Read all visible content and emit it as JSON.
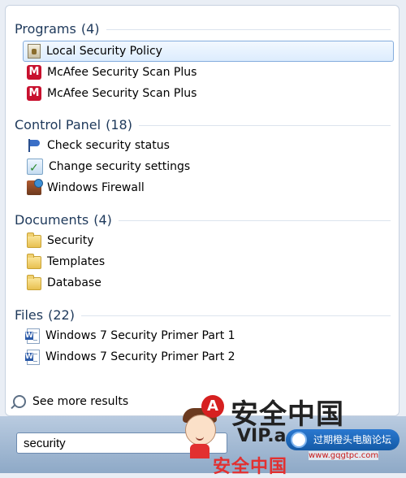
{
  "sections": [
    {
      "title": "Programs",
      "count": "(4)",
      "items": [
        {
          "label": "Local Security Policy",
          "icon": "security-policy-icon",
          "selected": true
        },
        {
          "label": "McAfee Security Scan Plus",
          "icon": "mcafee-icon"
        },
        {
          "label": "McAfee Security Scan Plus",
          "icon": "mcafee-icon"
        }
      ]
    },
    {
      "title": "Control Panel",
      "count": "(18)",
      "items": [
        {
          "label": "Check security status",
          "icon": "action-center-flag-icon"
        },
        {
          "label": "Change security settings",
          "icon": "security-settings-icon"
        },
        {
          "label": "Windows Firewall",
          "icon": "firewall-icon"
        }
      ]
    },
    {
      "title": "Documents",
      "count": "(4)",
      "items": [
        {
          "label": "Security",
          "icon": "folder-icon"
        },
        {
          "label": "Templates",
          "icon": "folder-icon"
        },
        {
          "label": "Database",
          "icon": "folder-icon"
        }
      ]
    },
    {
      "title": "Files",
      "count": "(22)",
      "items": [
        {
          "label": "Windows 7 Security Primer Part 1",
          "icon": "word-document-icon"
        },
        {
          "label": "Windows 7 Security Primer Part 2",
          "icon": "word-document-icon"
        }
      ]
    }
  ],
  "see_more": {
    "label": "See more results",
    "icon": "magnifier-icon"
  },
  "search": {
    "value": "security"
  },
  "watermark": {
    "logo_letter": "A",
    "title": "安全中国",
    "vip": "VIP.a",
    "tag": "过期橙头电脑论坛",
    "url": "www.gqgtpc.com",
    "banner": "安全中国"
  },
  "colors": {
    "header_text": "#1e395b",
    "selection_border": "#84acdd",
    "mcafee_red": "#c8102e"
  }
}
